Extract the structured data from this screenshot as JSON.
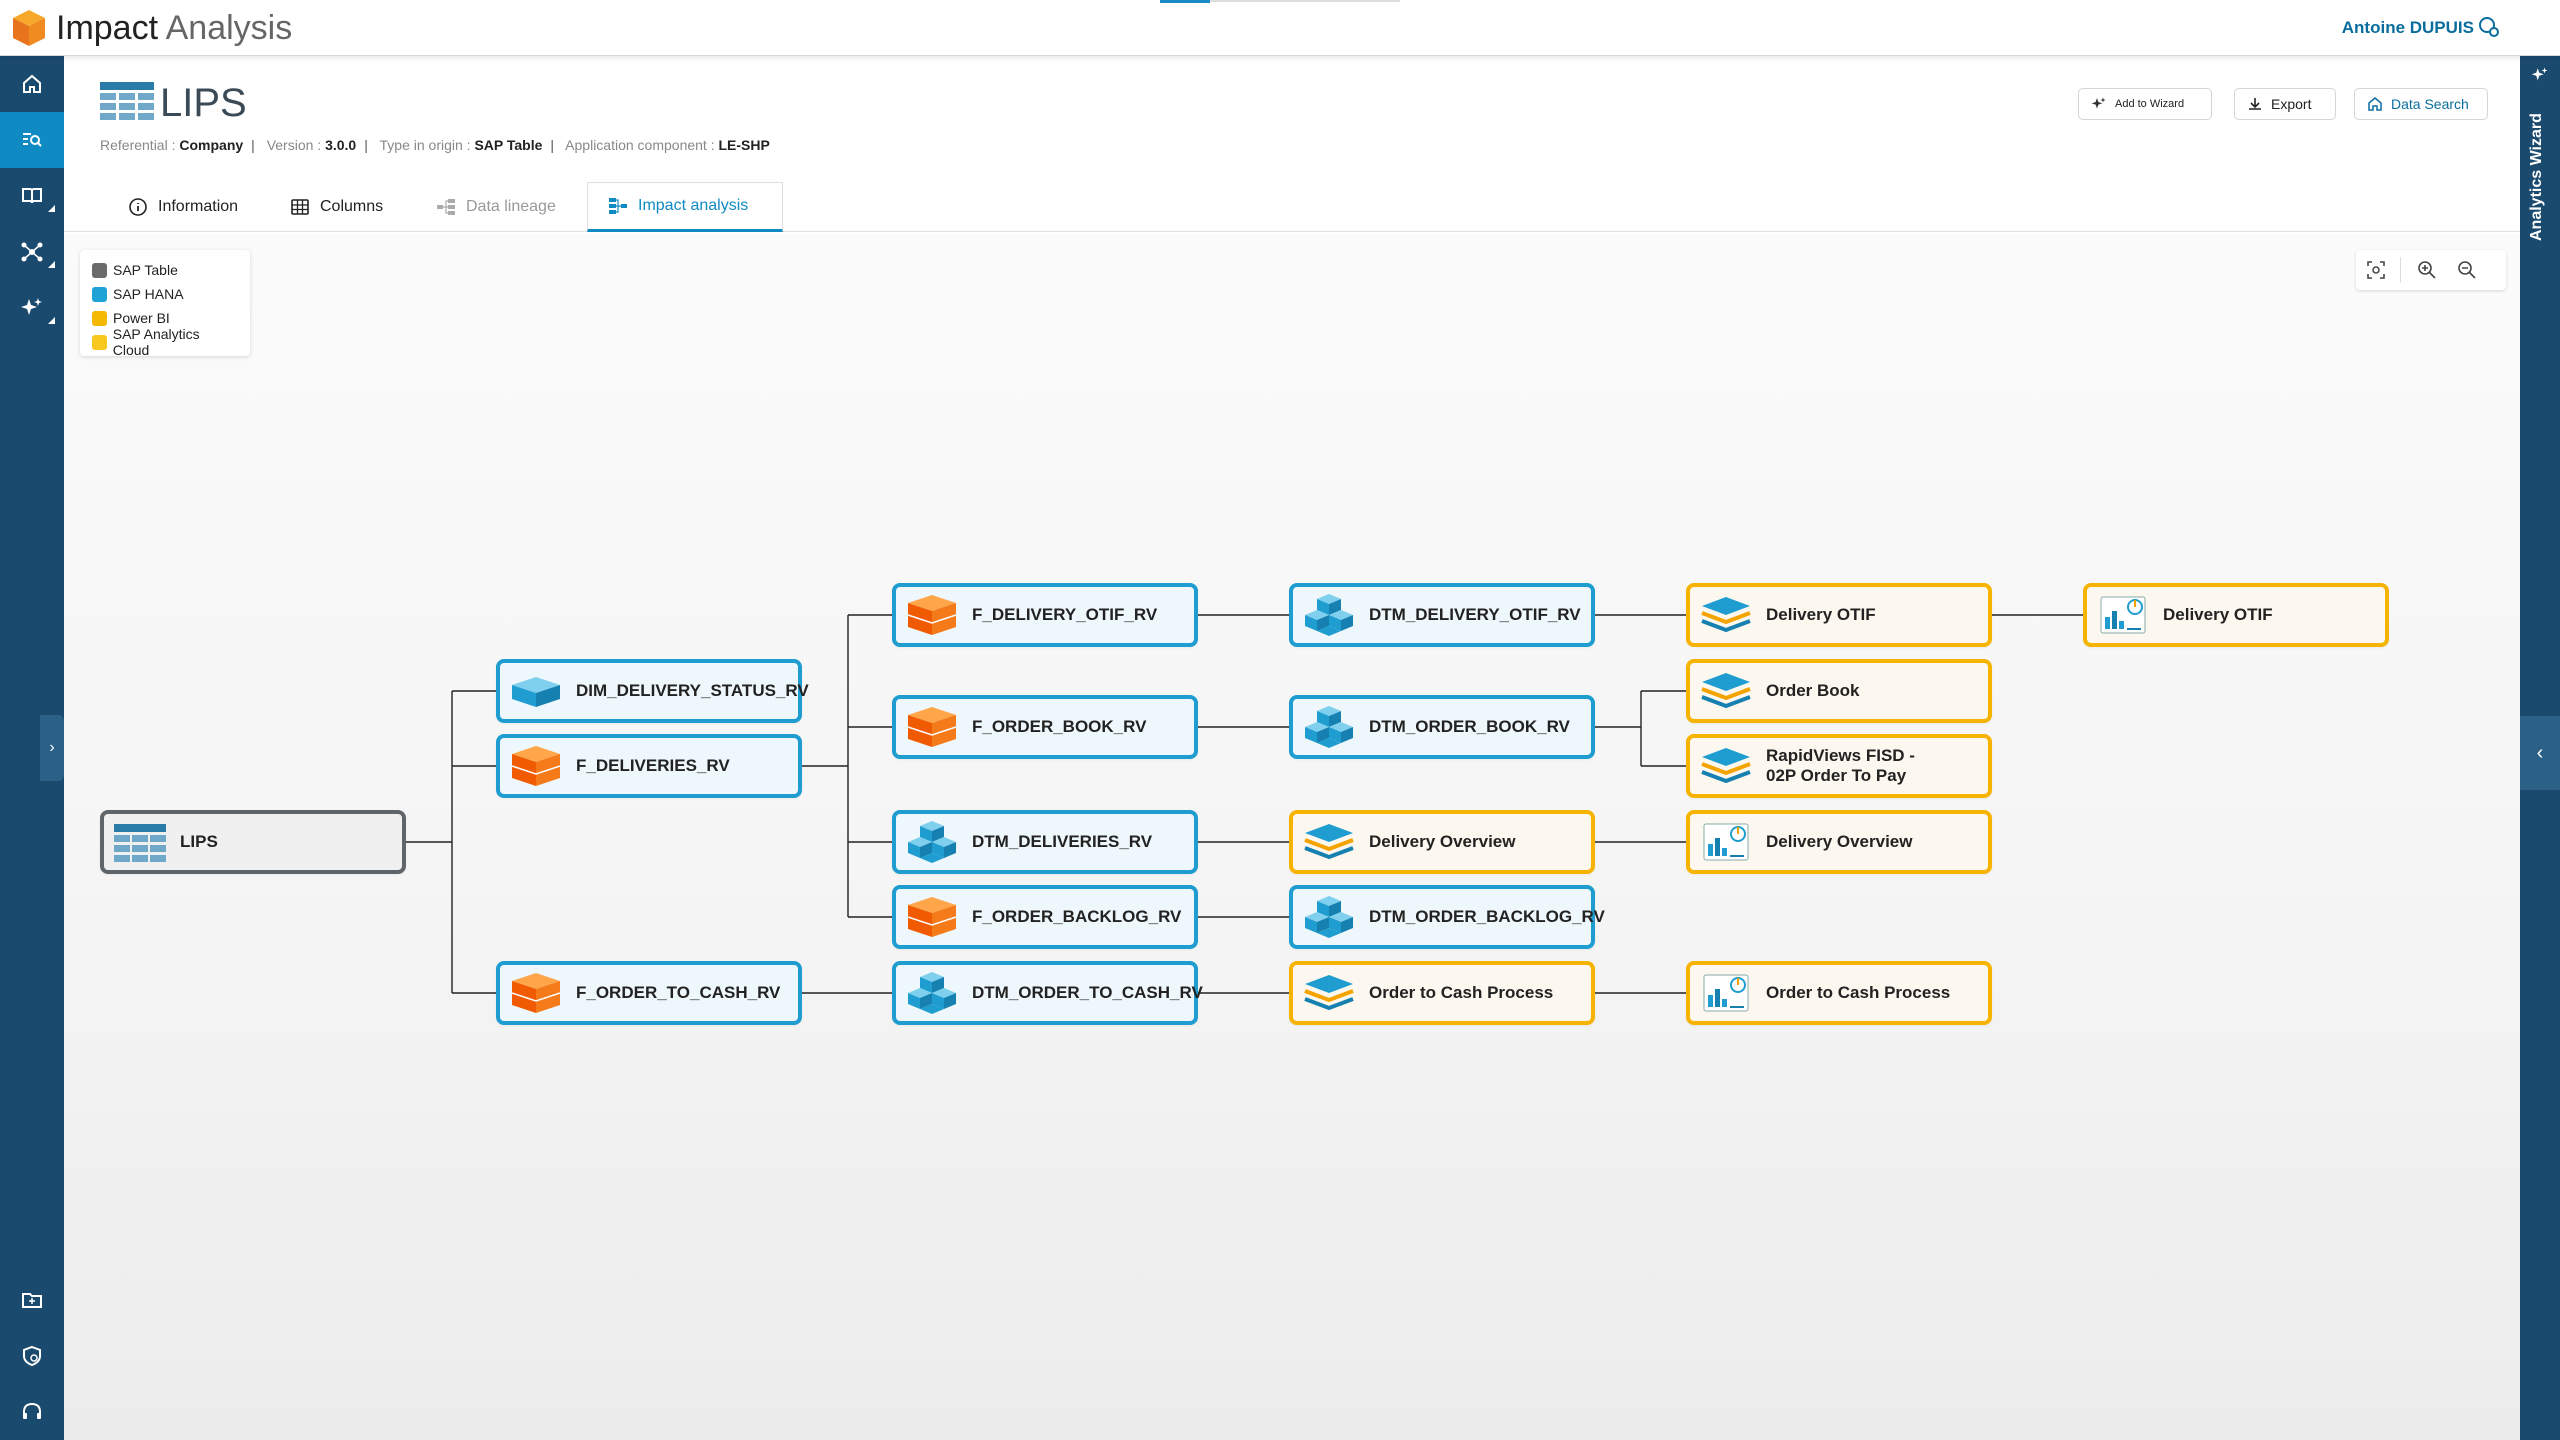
{
  "app": {
    "title_strong": "Impact",
    "title_light": "Analysis",
    "user": "Antoine DUPUIS"
  },
  "entity": {
    "name": "LIPS",
    "referential_label": "Referential :",
    "referential": "Company",
    "version_label": "Version :",
    "version": "3.0.0",
    "type_label": "Type in origin :",
    "type": "SAP Table",
    "component_label": "Application component :",
    "component": "LE-SHP"
  },
  "buttons": {
    "add_to_wizard": "Add to Wizard",
    "export": "Export",
    "data_search": "Data Search"
  },
  "right_panel": {
    "label": "Analytics Wizard"
  },
  "tabs": {
    "information": "Information",
    "columns": "Columns",
    "data_lineage": "Data lineage",
    "impact_analysis": "Impact analysis"
  },
  "legend": [
    {
      "label": "SAP Table",
      "color": "#6b6b6b"
    },
    {
      "label": "SAP HANA",
      "color": "#1fa3d7"
    },
    {
      "label": "Power BI",
      "color": "#f5b800"
    },
    {
      "label": "SAP Analytics Cloud",
      "color": "#f9c81e"
    }
  ],
  "graph": {
    "nodes": {
      "lips": {
        "label": "LIPS",
        "kind": "SAP Table",
        "icon": "table-icon"
      },
      "dim_delivery_status": {
        "label": "DIM_DELIVERY_STATUS_RV",
        "kind": "SAP HANA",
        "icon": "dimension-icon"
      },
      "f_deliveries": {
        "label": "F_DELIVERIES_RV",
        "kind": "SAP HANA",
        "icon": "fact-cube-icon"
      },
      "f_order_to_cash": {
        "label": "F_ORDER_TO_CASH_RV",
        "kind": "SAP HANA",
        "icon": "fact-cube-icon"
      },
      "f_delivery_otif": {
        "label": "F_DELIVERY_OTIF_RV",
        "kind": "SAP HANA",
        "icon": "fact-cube-icon"
      },
      "f_order_book": {
        "label": "F_ORDER_BOOK_RV",
        "kind": "SAP HANA",
        "icon": "fact-cube-icon"
      },
      "dtm_deliveries": {
        "label": "DTM_DELIVERIES_RV",
        "kind": "SAP HANA",
        "icon": "datamart-cubes-icon"
      },
      "f_order_backlog": {
        "label": "F_ORDER_BACKLOG_RV",
        "kind": "SAP HANA",
        "icon": "fact-cube-icon"
      },
      "dtm_order_to_cash": {
        "label": "DTM_ORDER_TO_CASH_RV",
        "kind": "SAP HANA",
        "icon": "datamart-cubes-icon"
      },
      "dtm_delivery_otif": {
        "label": "DTM_DELIVERY_OTIF_RV",
        "kind": "SAP HANA",
        "icon": "datamart-cubes-icon"
      },
      "dtm_order_book": {
        "label": "DTM_ORDER_BOOK_RV",
        "kind": "SAP HANA",
        "icon": "datamart-cubes-icon"
      },
      "delivery_overview_ds": {
        "label": "Delivery Overview",
        "kind": "Power BI",
        "icon": "dataset-layers-icon"
      },
      "dtm_order_backlog": {
        "label": "DTM_ORDER_BACKLOG_RV",
        "kind": "SAP HANA",
        "icon": "datamart-cubes-icon"
      },
      "order_to_cash_ds": {
        "label": "Order to Cash Process",
        "kind": "Power BI",
        "icon": "dataset-layers-icon"
      },
      "delivery_otif_ds": {
        "label": "Delivery OTIF",
        "kind": "Power BI",
        "icon": "dataset-layers-icon"
      },
      "order_book_ds": {
        "label": "Order Book",
        "kind": "Power BI",
        "icon": "dataset-layers-icon"
      },
      "rapidviews": {
        "label": "RapidViews FISD - 02P Order To Pay",
        "kind": "Power BI",
        "icon": "dataset-layers-icon"
      },
      "delivery_overview_rpt": {
        "label": "Delivery Overview",
        "kind": "Power BI",
        "icon": "report-chart-icon"
      },
      "order_to_cash_rpt": {
        "label": "Order to Cash Process",
        "kind": "Power BI",
        "icon": "report-chart-icon"
      },
      "delivery_otif_rpt": {
        "label": "Delivery OTIF",
        "kind": "Power BI",
        "icon": "report-chart-icon"
      }
    },
    "edges": [
      [
        "lips",
        "dim_delivery_status"
      ],
      [
        "lips",
        "f_deliveries"
      ],
      [
        "lips",
        "f_order_to_cash"
      ],
      [
        "f_deliveries",
        "f_delivery_otif"
      ],
      [
        "f_deliveries",
        "f_order_book"
      ],
      [
        "f_deliveries",
        "dtm_deliveries"
      ],
      [
        "f_deliveries",
        "f_order_backlog"
      ],
      [
        "f_order_to_cash",
        "dtm_order_to_cash"
      ],
      [
        "f_delivery_otif",
        "dtm_delivery_otif"
      ],
      [
        "f_order_book",
        "dtm_order_book"
      ],
      [
        "dtm_deliveries",
        "delivery_overview_ds"
      ],
      [
        "f_order_backlog",
        "dtm_order_backlog"
      ],
      [
        "dtm_order_to_cash",
        "order_to_cash_ds"
      ],
      [
        "dtm_delivery_otif",
        "delivery_otif_ds"
      ],
      [
        "dtm_order_book",
        "order_book_ds"
      ],
      [
        "dtm_order_book",
        "rapidviews"
      ],
      [
        "delivery_overview_ds",
        "delivery_overview_rpt"
      ],
      [
        "order_to_cash_ds",
        "order_to_cash_rpt"
      ],
      [
        "delivery_otif_ds",
        "delivery_otif_rpt"
      ]
    ]
  }
}
